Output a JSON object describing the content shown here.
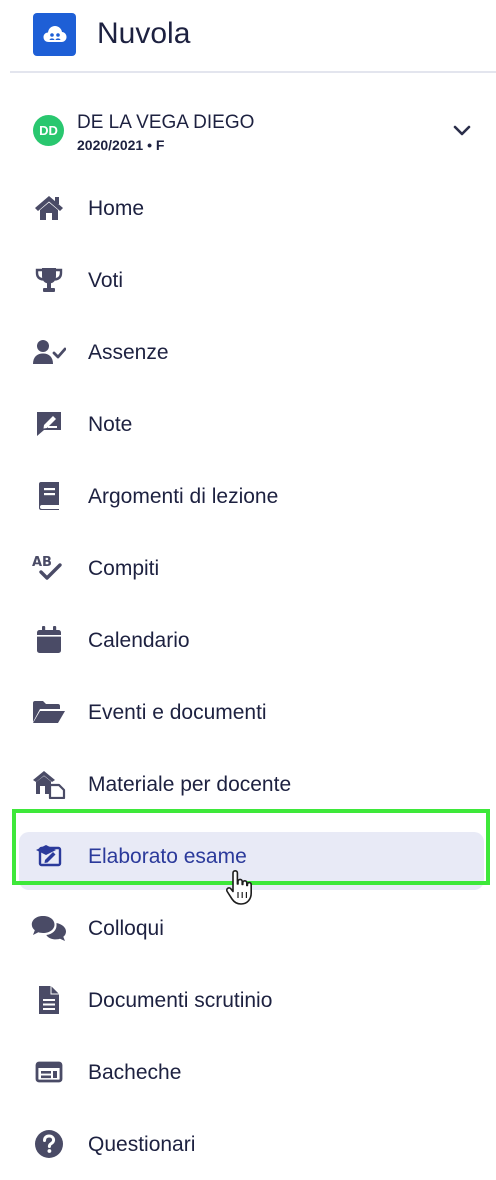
{
  "app": {
    "title": "Nuvola"
  },
  "user": {
    "initials": "DD",
    "name": "DE LA VEGA DIEGO",
    "subtitle": "2020/2021 • F"
  },
  "colors": {
    "brand": "#1e5fd6",
    "avatar": "#29c76f",
    "text": "#1d2140",
    "icon": "#4a4b66",
    "active_bg": "#e8eaf6",
    "active_text": "#2b3a9b",
    "highlight": "#3ee83a"
  },
  "menu": {
    "items": [
      {
        "label": "Home",
        "icon": "home-icon"
      },
      {
        "label": "Voti",
        "icon": "trophy-icon"
      },
      {
        "label": "Assenze",
        "icon": "user-check-icon"
      },
      {
        "label": "Note",
        "icon": "note-icon"
      },
      {
        "label": "Argomenti di lezione",
        "icon": "book-icon"
      },
      {
        "label": "Compiti",
        "icon": "spellcheck-icon"
      },
      {
        "label": "Calendario",
        "icon": "calendar-icon"
      },
      {
        "label": "Eventi e documenti",
        "icon": "folder-open-icon"
      },
      {
        "label": "Materiale per docente",
        "icon": "house-file-icon"
      },
      {
        "label": "Elaborato esame",
        "icon": "exam-icon",
        "active": true
      },
      {
        "label": "Colloqui",
        "icon": "comments-icon"
      },
      {
        "label": "Documenti scrutinio",
        "icon": "document-icon"
      },
      {
        "label": "Bacheche",
        "icon": "board-icon"
      },
      {
        "label": "Questionari",
        "icon": "question-circle-icon"
      }
    ]
  }
}
